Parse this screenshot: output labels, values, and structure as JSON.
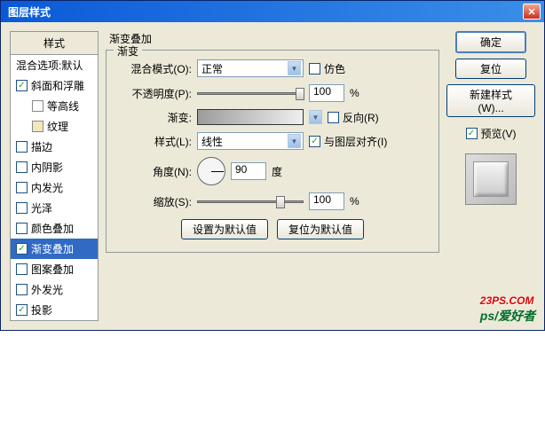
{
  "title": "图层样式",
  "sidebar": {
    "header": "样式",
    "blend_options": "混合选项:默认",
    "items": [
      {
        "label": "斜面和浮雕",
        "checked": true
      },
      {
        "label": "等高线",
        "checked": false,
        "indent": true,
        "swatch": "#ffffff"
      },
      {
        "label": "纹理",
        "checked": false,
        "indent": true,
        "swatch": "#f2e8bd"
      },
      {
        "label": "描边",
        "checked": false
      },
      {
        "label": "内阴影",
        "checked": false
      },
      {
        "label": "内发光",
        "checked": false
      },
      {
        "label": "光泽",
        "checked": false
      },
      {
        "label": "颜色叠加",
        "checked": false
      },
      {
        "label": "渐变叠加",
        "checked": true,
        "selected": true
      },
      {
        "label": "图案叠加",
        "checked": false
      },
      {
        "label": "外发光",
        "checked": false
      },
      {
        "label": "投影",
        "checked": true
      }
    ]
  },
  "main": {
    "title": "渐变叠加",
    "fieldset": "渐变",
    "blend_mode_label": "混合模式(O):",
    "blend_mode_value": "正常",
    "dither_label": "仿色",
    "opacity_label": "不透明度(P):",
    "opacity_value": "100",
    "percent": "%",
    "gradient_label": "渐变:",
    "reverse_label": "反向(R)",
    "style_label": "样式(L):",
    "style_value": "线性",
    "align_label": "与图层对齐(I)",
    "angle_label": "角度(N):",
    "angle_value": "90",
    "degree": "度",
    "scale_label": "缩放(S):",
    "scale_value": "100",
    "reset_default": "设置为默认值",
    "restore_default": "复位为默认值"
  },
  "buttons": {
    "ok": "确定",
    "cancel": "复位",
    "new_style": "新建样式(W)...",
    "preview": "预览(V)"
  },
  "watermark": {
    "line1": "23PS.COM",
    "line2": "ps/爱好者"
  }
}
